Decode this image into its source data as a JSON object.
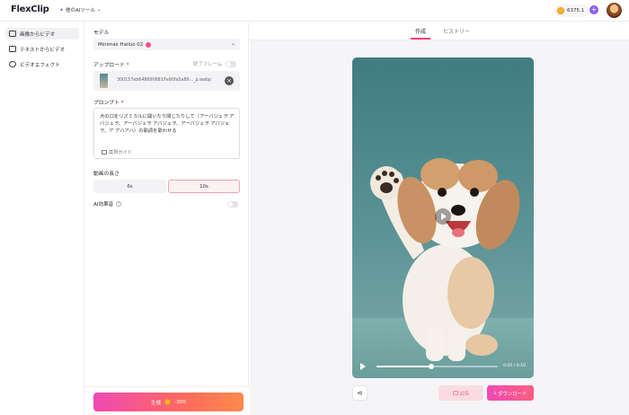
{
  "header": {
    "logo_text": "FlexClip",
    "ai_tools_label": "他のAIツール",
    "credits": "6375.1",
    "plus_label": "+"
  },
  "sidebar": {
    "items": [
      {
        "label": "画像からビデオ",
        "icon": "image-to-video-icon",
        "active": true
      },
      {
        "label": "テキストからビデオ",
        "icon": "text-to-video-icon",
        "active": false
      },
      {
        "label": "ビデオエフェクト",
        "icon": "video-effect-icon",
        "active": false
      }
    ]
  },
  "settings": {
    "model_label": "モデル",
    "model_value": "Minimax Hailuo 02",
    "upload_label": "アップロード",
    "end_frame_label": "終了フレーム",
    "upload_filename": "300157eb6486906817e90fa5a89..._p.webp",
    "prompt_label": "プロンプト",
    "prompt_text": "犬の口をリズミカルに開いたり閉じたりして（アーバジェヲ アバジェヲ、アーバジェヲ アバジェヲ、アーバジェヲ アバジェヲ、ア アハアハ）の歌詞を歌わせる",
    "prompt_guide": "案例ガイド",
    "duration_label": "動画の長さ",
    "duration_options": [
      "6s",
      "10s"
    ],
    "duration_selected": "10s",
    "ai_sound_label": "AI効果音",
    "generate_label": "生成",
    "generate_cost": "-300"
  },
  "preview": {
    "tabs": [
      "作成",
      "ヒストリー"
    ],
    "active_tab": "作成",
    "video_time": "0:05 / 0:10",
    "progress": 0.45,
    "edit_label": "編集",
    "download_label": "ダウンロード"
  },
  "colors": {
    "accent": "#ff3d7f",
    "purple": "#8b5cf6",
    "coin": "#f7b52c"
  }
}
